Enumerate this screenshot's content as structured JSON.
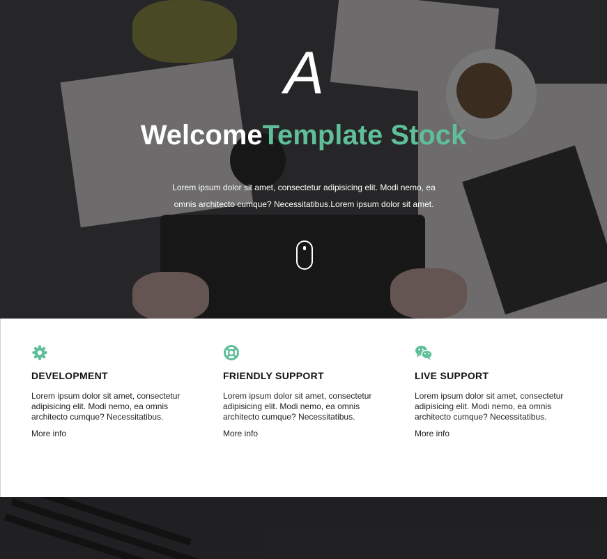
{
  "hero": {
    "logo": "A",
    "welcome": "Welcome",
    "brand": "Template Stock",
    "lead": "Lorem ipsum dolor sit amet, consectetur adipisicing elit. Modi nemo, ea omnis architecto cumque? Necessitatibus.Lorem ipsum dolor sit amet.",
    "scroll_icon": "mouse-scroll-icon"
  },
  "features": [
    {
      "icon": "gear-icon",
      "title": "DEVELOPMENT",
      "text": "Lorem ipsum dolor sit amet, consectetur adipisicing elit. Modi nemo, ea omnis architecto cumque? Necessitatibus.",
      "link": "More info"
    },
    {
      "icon": "life-ring-icon",
      "title": "FRIENDLY SUPPORT",
      "text": "Lorem ipsum dolor sit amet, consectetur adipisicing elit. Modi nemo, ea omnis architecto cumque? Necessitatibus.",
      "link": "More info"
    },
    {
      "icon": "chat-bubbles-icon",
      "title": "LIVE SUPPORT",
      "text": "Lorem ipsum dolor sit amet, consectetur adipisicing elit. Modi nemo, ea omnis architecto cumque? Necessitatibus.",
      "link": "More info"
    }
  ],
  "colors": {
    "accent": "#5fbf98",
    "hero_overlay": "#1b1a1c",
    "text": "#111111"
  }
}
